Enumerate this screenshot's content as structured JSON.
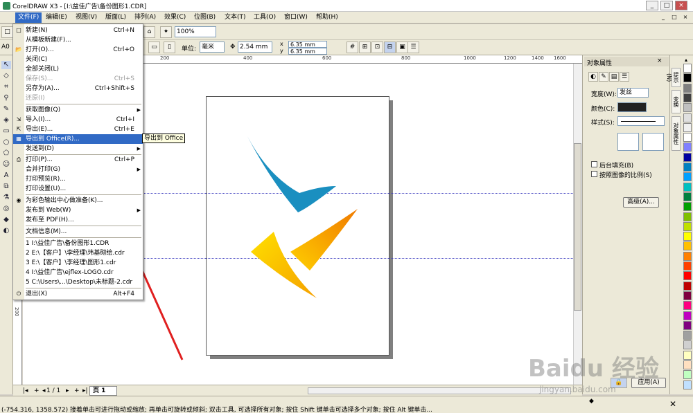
{
  "window": {
    "title": "CorelDRAW X3 - [I:\\益佳广告\\备份图形1.CDR]",
    "buttons": [
      "_",
      "□",
      "×"
    ]
  },
  "menubar": {
    "items": [
      "文件(F)",
      "编辑(E)",
      "视图(V)",
      "版面(L)",
      "排列(A)",
      "效果(C)",
      "位图(B)",
      "文本(T)",
      "工具(O)",
      "窗口(W)",
      "帮助(H)"
    ],
    "active": "文件(F)"
  },
  "toolbar": {
    "zoom": "100%",
    "units_label": "单位:",
    "units_value": "毫米",
    "nudge": "2.54 mm",
    "dup_x": "6.35 mm",
    "dup_y": "6.35 mm",
    "page_size_w": "A0"
  },
  "file_menu": {
    "items": [
      {
        "label": "新建(N)",
        "shortcut": "Ctrl+N",
        "disabled": false
      },
      {
        "label": "从模板新建(F)...",
        "shortcut": "",
        "disabled": false
      },
      {
        "label": "打开(O)...",
        "shortcut": "Ctrl+O",
        "disabled": false
      },
      {
        "label": "关闭(C)",
        "shortcut": "",
        "disabled": false
      },
      {
        "label": "全部关闭(L)",
        "shortcut": "",
        "disabled": false
      },
      {
        "label": "保存(S)...",
        "shortcut": "Ctrl+S",
        "disabled": true
      },
      {
        "label": "另存为(A)...",
        "shortcut": "Ctrl+Shift+S",
        "disabled": false
      },
      {
        "label": "还原(I)",
        "shortcut": "",
        "disabled": true
      },
      {
        "label": "获取图像(Q)",
        "shortcut": "",
        "disabled": false,
        "submenu": true
      },
      {
        "label": "导入(I)...",
        "shortcut": "Ctrl+I",
        "disabled": false
      },
      {
        "label": "导出(E)...",
        "shortcut": "Ctrl+E",
        "disabled": false
      },
      {
        "label": "导出到 Office(R)...",
        "shortcut": "",
        "disabled": false,
        "highlighted": true
      },
      {
        "label": "发送到(D)",
        "shortcut": "",
        "disabled": false,
        "submenu": true
      },
      {
        "label": "打印(P)...",
        "shortcut": "Ctrl+P",
        "disabled": false
      },
      {
        "label": "合并打印(G)",
        "shortcut": "",
        "disabled": false,
        "submenu": true
      },
      {
        "label": "打印预览(R)...",
        "shortcut": "",
        "disabled": false
      },
      {
        "label": "打印设置(U)...",
        "shortcut": "",
        "disabled": false
      },
      {
        "label": "为彩色输出中心做准备(K)...",
        "shortcut": "",
        "disabled": false
      },
      {
        "label": "发布到 Web(W)",
        "shortcut": "",
        "disabled": false,
        "submenu": true
      },
      {
        "label": "发布至 PDF(H)...",
        "shortcut": "",
        "disabled": false
      },
      {
        "label": "文档信息(M)...",
        "shortcut": "",
        "disabled": false
      },
      {
        "label": "1 I:\\益佳广告\\备份图形1.CDR",
        "shortcut": "",
        "disabled": false
      },
      {
        "label": "2 E:\\【客户】\\李经理\\玮基砌绘.cdr",
        "shortcut": "",
        "disabled": false
      },
      {
        "label": "3 E:\\【客户】\\李经理\\图形1.cdr",
        "shortcut": "",
        "disabled": false
      },
      {
        "label": "4 I:\\益佳广告\\ejflex-LOGO.cdr",
        "shortcut": "",
        "disabled": false
      },
      {
        "label": "5 C:\\Users\\...\\Desktop\\未标题-2.cdr",
        "shortcut": "",
        "disabled": false
      },
      {
        "label": "退出(X)",
        "shortcut": "Alt+F4",
        "disabled": false
      }
    ]
  },
  "tooltip": "导出到 Office",
  "ruler": {
    "top_ticks": [
      "200",
      "400",
      "600",
      "800",
      "1000",
      "1200",
      "1400",
      "1600"
    ],
    "left_ticks": [
      "200"
    ]
  },
  "docker": {
    "title": "对象属性",
    "width_label": "宽度(W):",
    "width_value": "发丝",
    "color_label": "颜色(C):",
    "style_label": "样式(S):",
    "behind_fill": "后台填充(B)",
    "scale_with_image": "按照图像的比例(S)",
    "advanced_button": "高级(A)...",
    "apply_button": "应用(A)"
  },
  "side_tabs": [
    "提示(N)",
    "变换",
    "对象属性"
  ],
  "palette": [
    "#ffffff",
    "#000000",
    "#808080",
    "#404040",
    "#c0c0c0",
    "#e0e0e0",
    "#f0f0f0",
    "#ffffff",
    "#8080ff",
    "#0000a0",
    "#0080c0",
    "#00a0ff",
    "#00c0c0",
    "#008040",
    "#00a000",
    "#80c000",
    "#c0e000",
    "#ffff00",
    "#ffc000",
    "#ff8000",
    "#ff4000",
    "#ff0000",
    "#c00000",
    "#800040",
    "#ff0080",
    "#c000c0",
    "#800080",
    "#a0a0a0",
    "#d0d0d0",
    "#ffffc0",
    "#ffe0c0",
    "#c0ffc0",
    "#c0e0ff"
  ],
  "page_tabs": {
    "counter": "1 / 1",
    "page_label": "页 1"
  },
  "status": {
    "text": "(-754.316, 1358.572)  接着单击可进行拖动或缩放; 再单击可旋转或倾斜; 双击工具, 可选择所有对象; 按住 Shift 键单击可选择多个对象; 按住 Alt 键单击..."
  },
  "watermark": {
    "main": "Baidu 经验",
    "sub": "jingyan.baidu.com"
  },
  "colors": {
    "logo_blue": "#1a8fc0",
    "logo_yellow": "#f5b400",
    "logo_orange": "#f08c00",
    "arrow": "#e02020",
    "highlight": "#316ac5"
  }
}
